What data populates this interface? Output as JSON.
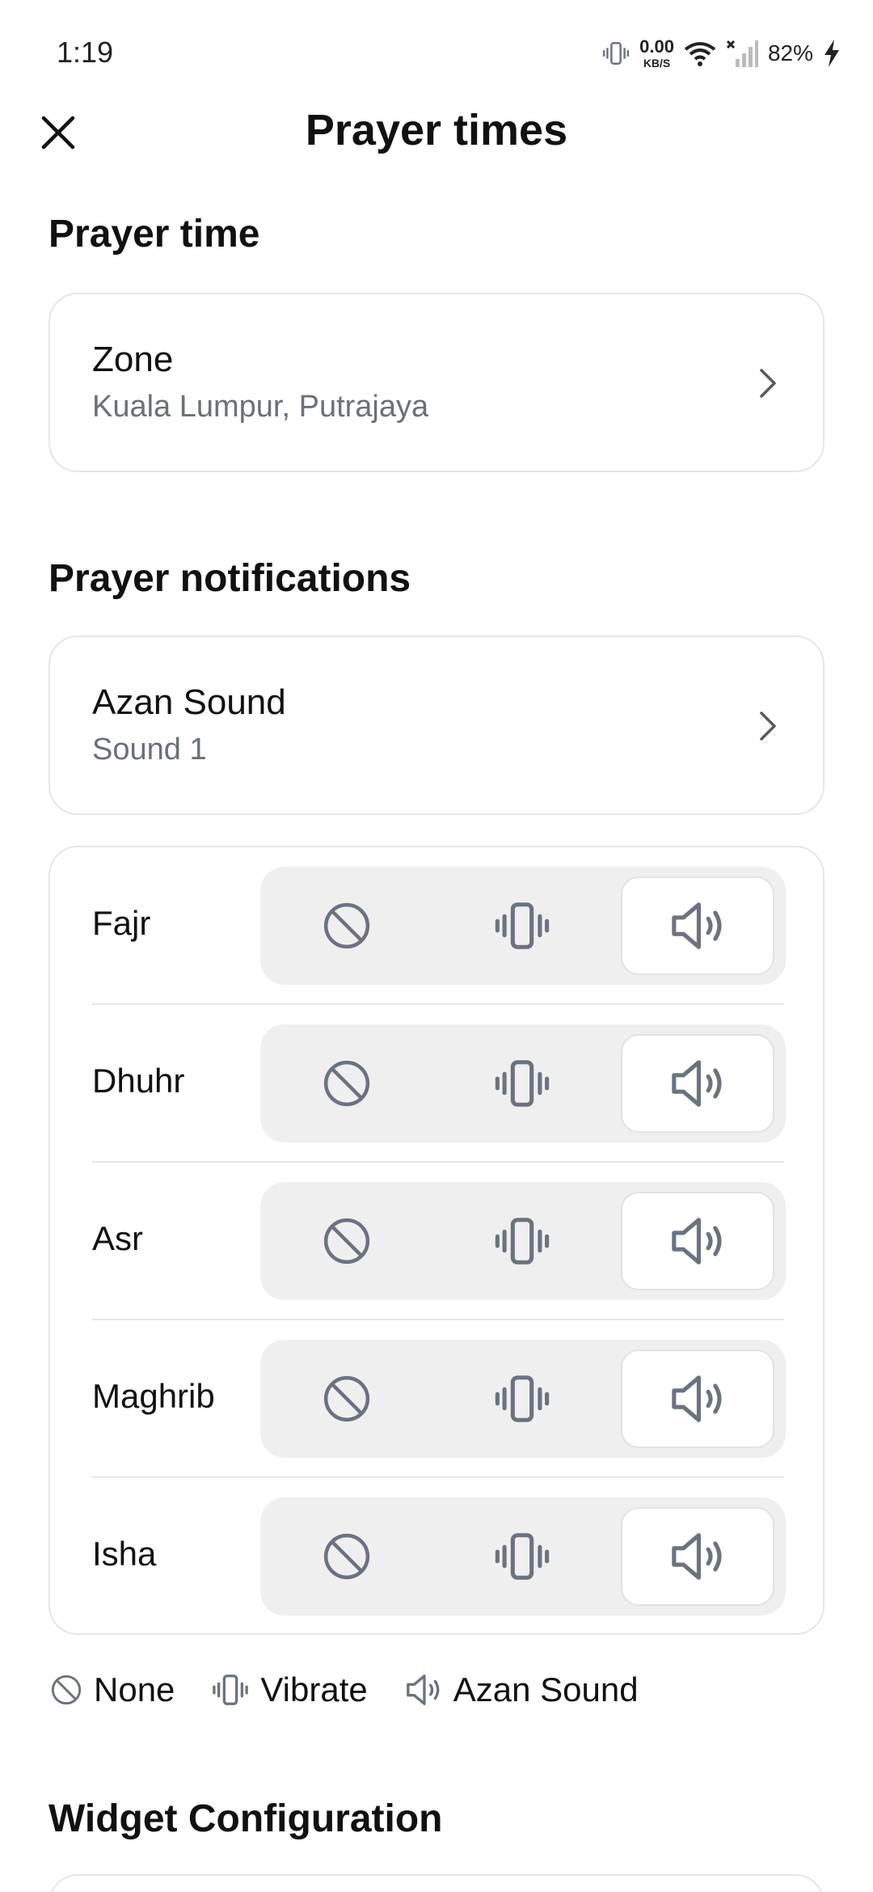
{
  "status_bar": {
    "time": "1:19",
    "net_speed_value": "0.00",
    "net_speed_unit": "KB/S",
    "battery_percent": "82%"
  },
  "header": {
    "title": "Prayer times"
  },
  "sections": {
    "prayer_time_title": "Prayer time",
    "notifications_title": "Prayer notifications",
    "widget_title": "Widget Configuration"
  },
  "zone": {
    "label": "Zone",
    "value": "Kuala Lumpur, Putrajaya"
  },
  "azan": {
    "label": "Azan Sound",
    "value": "Sound 1"
  },
  "prayers": [
    {
      "name": "Fajr",
      "mode": "azan"
    },
    {
      "name": "Dhuhr",
      "mode": "azan"
    },
    {
      "name": "Asr",
      "mode": "azan"
    },
    {
      "name": "Maghrib",
      "mode": "azan"
    },
    {
      "name": "Isha",
      "mode": "azan"
    }
  ],
  "legend": {
    "none": "None",
    "vibrate": "Vibrate",
    "azan": "Azan Sound"
  },
  "colors": {
    "icon": "#6b7280",
    "segment_bg": "#efefef",
    "border": "#e3e6ea"
  },
  "icons": {
    "close": "close-icon",
    "chevron": "chevron-right-icon",
    "none": "block-icon",
    "vibrate": "vibrate-icon",
    "azan": "speaker-icon"
  }
}
